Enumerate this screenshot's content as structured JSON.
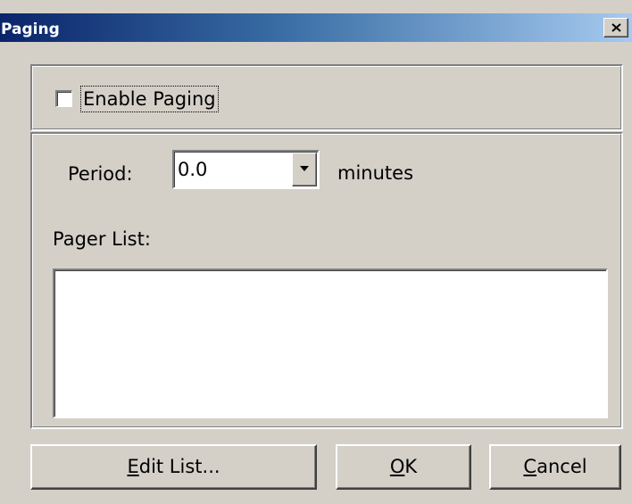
{
  "window": {
    "title": "Paging"
  },
  "enable_paging": {
    "label": "Enable Paging",
    "checked": false
  },
  "period": {
    "label": "Period:",
    "value": "0.0",
    "unit": "minutes"
  },
  "pager_list": {
    "label": "Pager List:",
    "items": []
  },
  "buttons": {
    "edit_list": {
      "mnemonic": "E",
      "rest": "dit List..."
    },
    "ok": {
      "mnemonic": "O",
      "rest": "K"
    },
    "cancel": {
      "mnemonic": "C",
      "rest": "ancel"
    }
  },
  "colors": {
    "title_gradient_start": "#0a246a",
    "title_gradient_end": "#a6caf0",
    "face": "#d4d0c8"
  }
}
